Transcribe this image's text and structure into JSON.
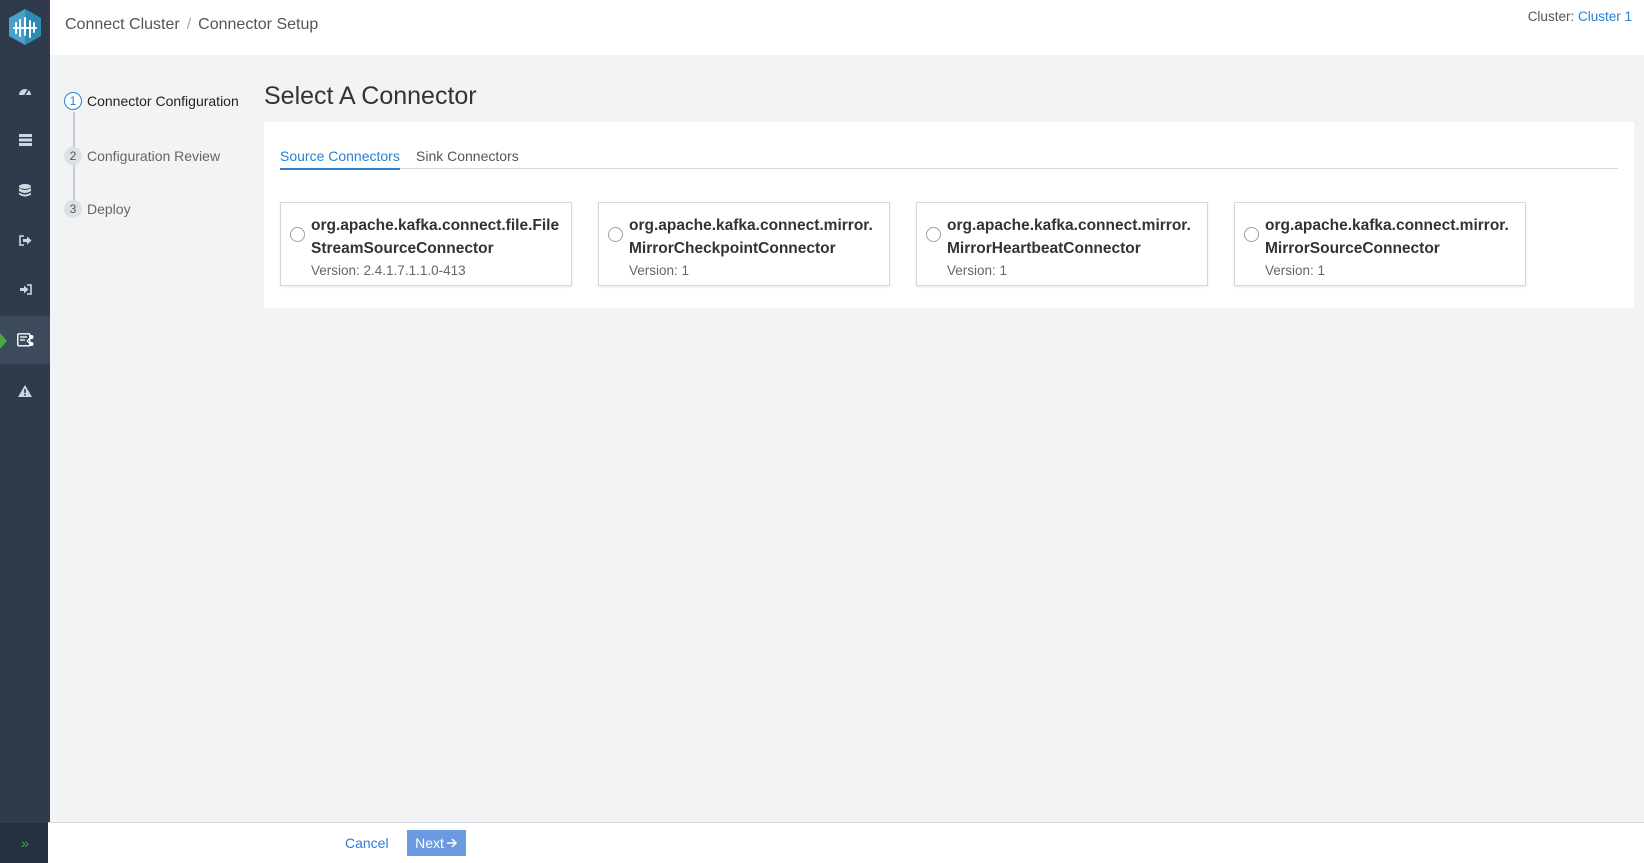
{
  "header": {
    "breadcrumb": [
      "Connect Cluster",
      "Connector Setup"
    ],
    "cluster_label": "Cluster:",
    "cluster_value": "Cluster 1"
  },
  "sidebar": {
    "items": [
      {
        "icon": "dashboard-icon"
      },
      {
        "icon": "brokers-icon"
      },
      {
        "icon": "topics-icon"
      },
      {
        "icon": "producers-icon"
      },
      {
        "icon": "consumers-icon"
      },
      {
        "icon": "connect-icon",
        "active": true
      },
      {
        "icon": "alerts-icon"
      }
    ],
    "expand_icon": "double-chevron-right-icon"
  },
  "steps": [
    {
      "number": "1",
      "label": "Connector Configuration",
      "active": true
    },
    {
      "number": "2",
      "label": "Configuration Review"
    },
    {
      "number": "3",
      "label": "Deploy"
    }
  ],
  "main": {
    "title": "Select A Connector",
    "tabs": [
      {
        "label": "Source Connectors",
        "active": true
      },
      {
        "label": "Sink Connectors"
      }
    ],
    "connectors": [
      {
        "name": "org.apache.kafka.connect.file.FileStreamSourceConnector",
        "version": "Version: 2.4.1.7.1.1.0-413"
      },
      {
        "name": "org.apache.kafka.connect.mirror.MirrorCheckpointConnector",
        "version": "Version: 1"
      },
      {
        "name": "org.apache.kafka.connect.mirror.MirrorHeartbeatConnector",
        "version": "Version: 1"
      },
      {
        "name": "org.apache.kafka.connect.mirror.MirrorSourceConnector",
        "version": "Version: 1"
      }
    ]
  },
  "footer": {
    "cancel_label": "Cancel",
    "next_label": "Next"
  },
  "colors": {
    "sidebar_bg": "#2f3a4a",
    "accent": "#2a7fd4",
    "active_marker": "#49a942",
    "next_button": "#6a9be0"
  }
}
